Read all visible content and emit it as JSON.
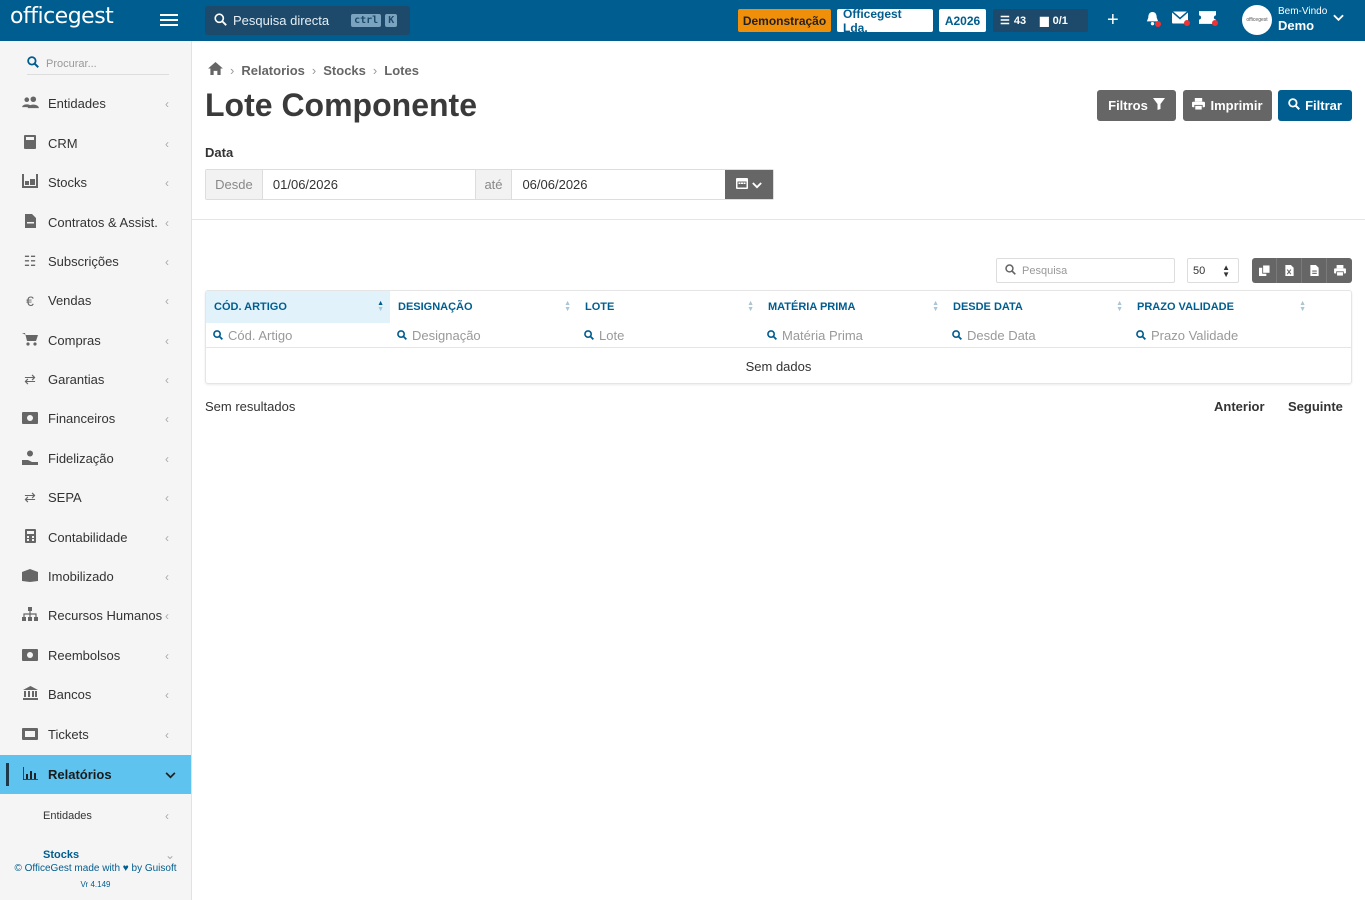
{
  "header": {
    "logo": "officegest",
    "search_label": "Pesquisa directa",
    "shortcut_ctrl": "ctrl",
    "shortcut_key": "K",
    "badge_demo": "Demonstração",
    "badge_company": "Officegest Lda.",
    "badge_year": "A2026",
    "tasks_count": "43",
    "docs_count": "0/1",
    "welcome": "Bem-Vindo",
    "user": "Demo",
    "avatar_text": "officegest"
  },
  "sidebar": {
    "search_placeholder": "Procurar...",
    "items": [
      {
        "label": "Entidades",
        "icon": "users-icon"
      },
      {
        "label": "CRM",
        "icon": "book-icon"
      },
      {
        "label": "Stocks",
        "icon": "warehouse-icon"
      },
      {
        "label": "Contratos & Assist.",
        "icon": "file-contract-icon"
      },
      {
        "label": "Subscrições",
        "icon": "list-icon"
      },
      {
        "label": "Vendas",
        "icon": "euro-icon"
      },
      {
        "label": "Compras",
        "icon": "cart-icon"
      },
      {
        "label": "Garantias",
        "icon": "exchange-icon"
      },
      {
        "label": "Financeiros",
        "icon": "money-icon"
      },
      {
        "label": "Fidelização",
        "icon": "hand-coin-icon"
      },
      {
        "label": "SEPA",
        "icon": "exchange-icon"
      },
      {
        "label": "Contabilidade",
        "icon": "calculator-icon"
      },
      {
        "label": "Imobilizado",
        "icon": "box-icon"
      },
      {
        "label": "Recursos Humanos",
        "icon": "sitemap-icon"
      },
      {
        "label": "Reembolsos",
        "icon": "money-icon"
      },
      {
        "label": "Bancos",
        "icon": "bank-icon"
      },
      {
        "label": "Tickets",
        "icon": "ticket-icon"
      },
      {
        "label": "Relatórios",
        "icon": "chart-icon"
      }
    ],
    "sub_items": [
      {
        "label": "Entidades"
      },
      {
        "label": "Stocks"
      }
    ],
    "footer": "© OfficeGest made with ♥ by Guisoft",
    "version": "Vr 4.149"
  },
  "breadcrumb": [
    "Relatorios",
    "Stocks",
    "Lotes"
  ],
  "page_title": "Lote Componente",
  "buttons": {
    "filtros": "Filtros",
    "imprimir": "Imprimir",
    "filtrar": "Filtrar"
  },
  "date_filter": {
    "label": "Data",
    "from_label": "Desde",
    "from_value": "01/06/2026",
    "to_label": "até",
    "to_value": "06/06/2026"
  },
  "table": {
    "search_placeholder": "Pesquisa",
    "page_size": "50",
    "columns": [
      {
        "label": "CÓD. ARTIGO",
        "filter": "Cód. Artigo"
      },
      {
        "label": "DESIGNAÇÃO",
        "filter": "Designação"
      },
      {
        "label": "LOTE",
        "filter": "Lote"
      },
      {
        "label": "MATÉRIA PRIMA",
        "filter": "Matéria Prima"
      },
      {
        "label": "DESDE DATA",
        "filter": "Desde Data"
      },
      {
        "label": "PRAZO VALIDADE",
        "filter": "Prazo Validade"
      }
    ],
    "empty": "Sem dados",
    "results": "Sem resultados",
    "prev": "Anterior",
    "next": "Seguinte"
  },
  "colors": {
    "primary": "#005d8f",
    "active_menu": "#5ec3ee",
    "demo_badge": "#f0900a"
  }
}
